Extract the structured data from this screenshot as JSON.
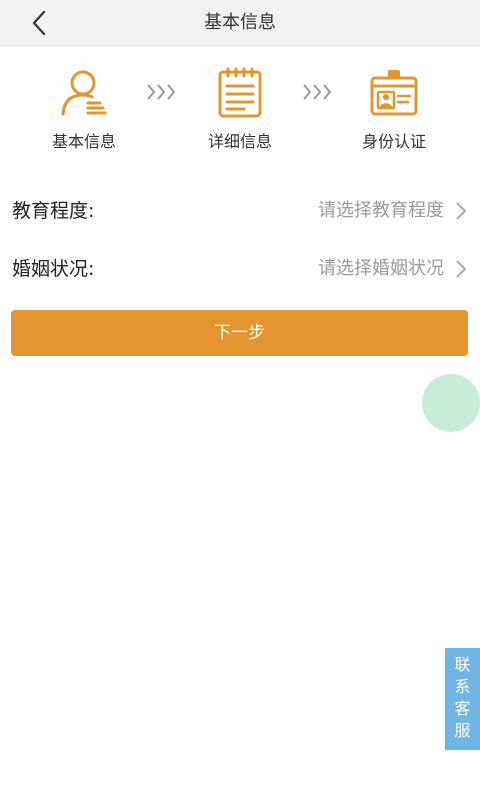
{
  "header": {
    "title": "基本信息"
  },
  "steps": [
    {
      "label": "基本信息",
      "icon": "user-profile-icon"
    },
    {
      "label": "详细信息",
      "icon": "notepad-icon"
    },
    {
      "label": "身份认证",
      "icon": "id-card-icon"
    }
  ],
  "form": {
    "education": {
      "label": "教育程度:",
      "placeholder": "请选择教育程度"
    },
    "marital": {
      "label": "婚姻状况:",
      "placeholder": "请选择婚姻状况"
    }
  },
  "next_button": {
    "label": "下一步"
  },
  "service": {
    "chars": [
      "联",
      "系",
      "客",
      "服"
    ]
  },
  "colors": {
    "accent": "#e4952f",
    "header_bg": "#f2f2f2",
    "float_circle": "#c9ecd6",
    "service_tab": "#6fb5e6",
    "placeholder_text": "#9a9a9a"
  }
}
